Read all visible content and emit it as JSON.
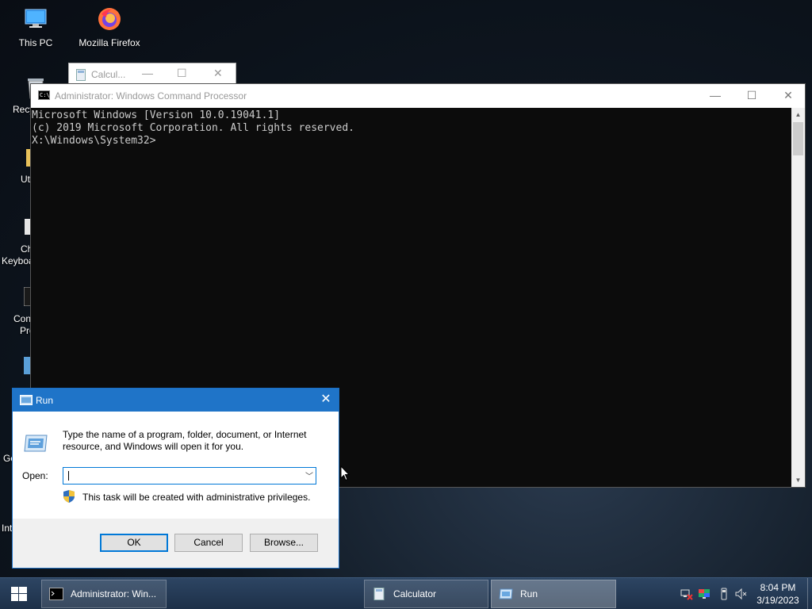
{
  "desktop": {
    "icons": [
      {
        "label": "This PC"
      },
      {
        "label": "Mozilla Firefox"
      }
    ],
    "partial_labels": [
      "Recy",
      "Ut",
      "Ch",
      "Keyboa",
      "Con",
      "Pro",
      "Go",
      "Int"
    ]
  },
  "calculator_window": {
    "title": "Calcul..."
  },
  "cmd": {
    "title": "Administrator: Windows Command Processor",
    "lines": [
      "Microsoft Windows [Version 10.0.19041.1]",
      "(c) 2019 Microsoft Corporation. All rights reserved.",
      "",
      "X:\\Windows\\System32>"
    ]
  },
  "run": {
    "title": "Run",
    "description": "Type the name of a program, folder, document, or Internet resource, and Windows will open it for you.",
    "open_label": "Open:",
    "open_value": "",
    "admin_note": "This task will be created with administrative privileges.",
    "ok_label": "OK",
    "cancel_label": "Cancel",
    "browse_label": "Browse..."
  },
  "taskbar": {
    "items": [
      {
        "label": "Administrator: Win...",
        "active": false
      },
      {
        "label": "Calculator",
        "active": false
      },
      {
        "label": "Run",
        "active": true
      }
    ],
    "clock_time": "8:04 PM",
    "clock_date": "3/19/2023"
  },
  "colors": {
    "run_titlebar": "#1f74c8",
    "taskbar": "#1d3048",
    "console_bg": "#0c0c0c",
    "console_text": "#cccccc"
  }
}
